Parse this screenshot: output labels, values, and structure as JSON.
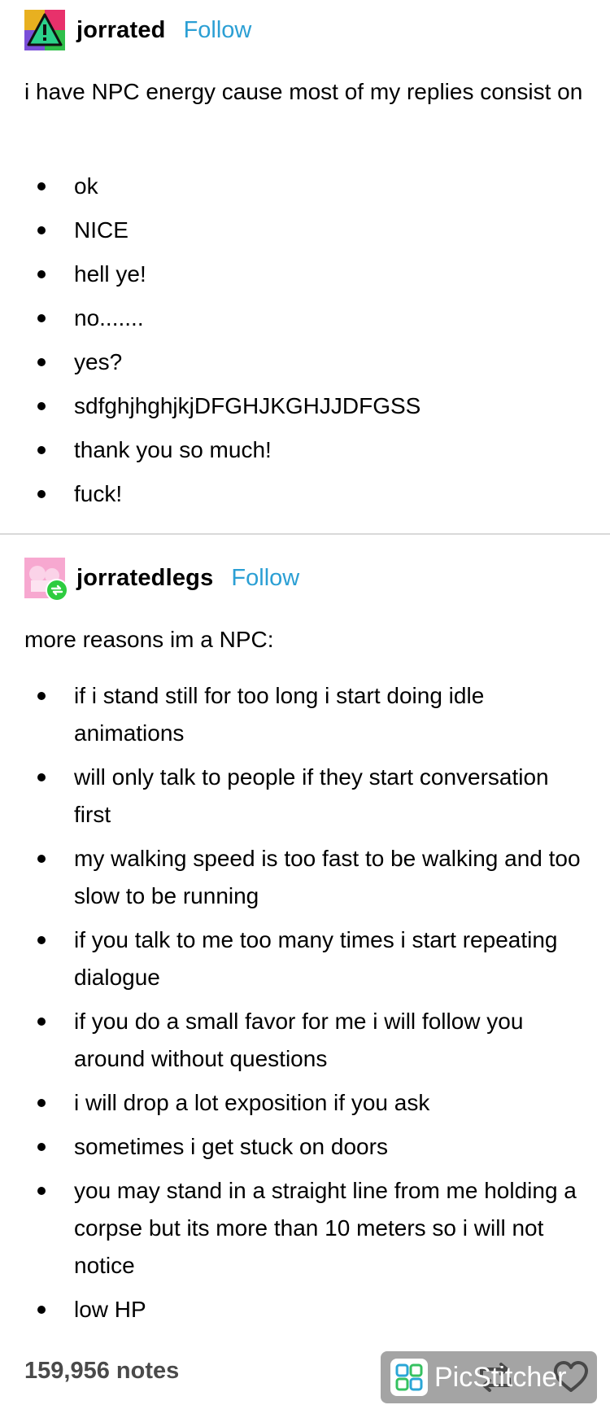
{
  "post1": {
    "username": "jorrated",
    "follow_label": "Follow",
    "intro": "i have NPC energy cause most of my replies consist on",
    "items": [
      "ok",
      "NICE",
      "hell ye!",
      "no.......",
      "yes?",
      "sdfghjhghjkjDFGHJKGHJJDFGSS",
      "thank you so much!",
      "fuck!"
    ]
  },
  "post2": {
    "username": "jorratedlegs",
    "follow_label": "Follow",
    "intro": "more reasons im a NPC:",
    "items": [
      "if i stand still for too long i start doing idle animations",
      "will only talk to people if they start conversation first",
      "my walking speed is too fast to be walking and too slow to be running",
      "if you talk to me too many times i start repeating dialogue",
      "if you do a small favor for me i will follow you around without questions",
      "i will drop a lot exposition if you ask",
      "sometimes i get stuck on doors",
      "you may stand in a straight line from me holding a corpse but its more than 10 meters so i will not notice",
      "low HP"
    ]
  },
  "footer": {
    "notes": "159,956 notes",
    "reblog_icon": "reblog-icon",
    "like_icon": "heart-icon"
  },
  "watermark": {
    "text": "PicStitcher"
  },
  "colors": {
    "follow": "#2b9fd4",
    "divider": "#d9d9d9",
    "notes": "#4a4a4a",
    "reblog_badge": "#2ecc40"
  }
}
